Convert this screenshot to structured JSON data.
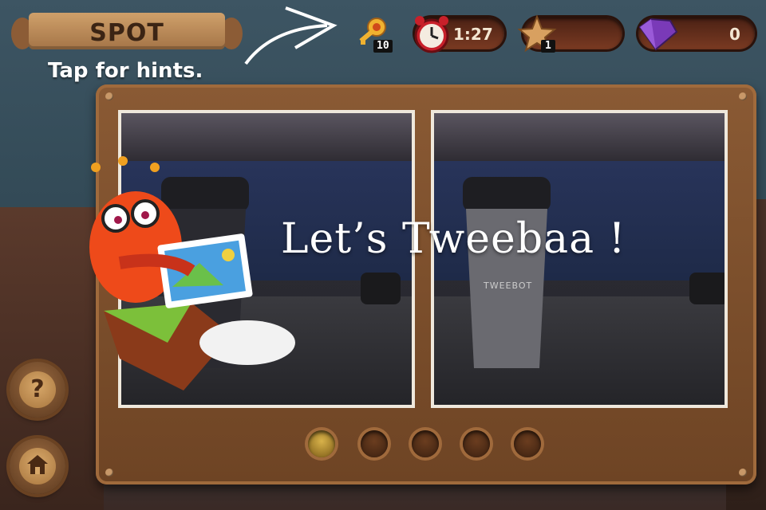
{
  "banner": {
    "title": "SPOT"
  },
  "hint": {
    "text": "Tap for hints."
  },
  "hud": {
    "keys": {
      "icon": "key-icon",
      "count": "10"
    },
    "timer": {
      "icon": "alarm-clock-icon",
      "value": "1:27"
    },
    "stars": {
      "icon": "star-icon",
      "count": "1"
    },
    "gems": {
      "icon": "purple-gem-icon",
      "count": "0"
    }
  },
  "overlay": {
    "text": "Let’s Tweebaa !"
  },
  "scene": {
    "cup_label": "TWEEBOT"
  },
  "level_dots": [
    true,
    false,
    false,
    false,
    false
  ],
  "side_buttons": {
    "help": "help-button",
    "home": "home-button"
  },
  "colors": {
    "frame": "#8a5a34",
    "hud_bg": "#5a2a18",
    "banner": "#cfa06a"
  }
}
